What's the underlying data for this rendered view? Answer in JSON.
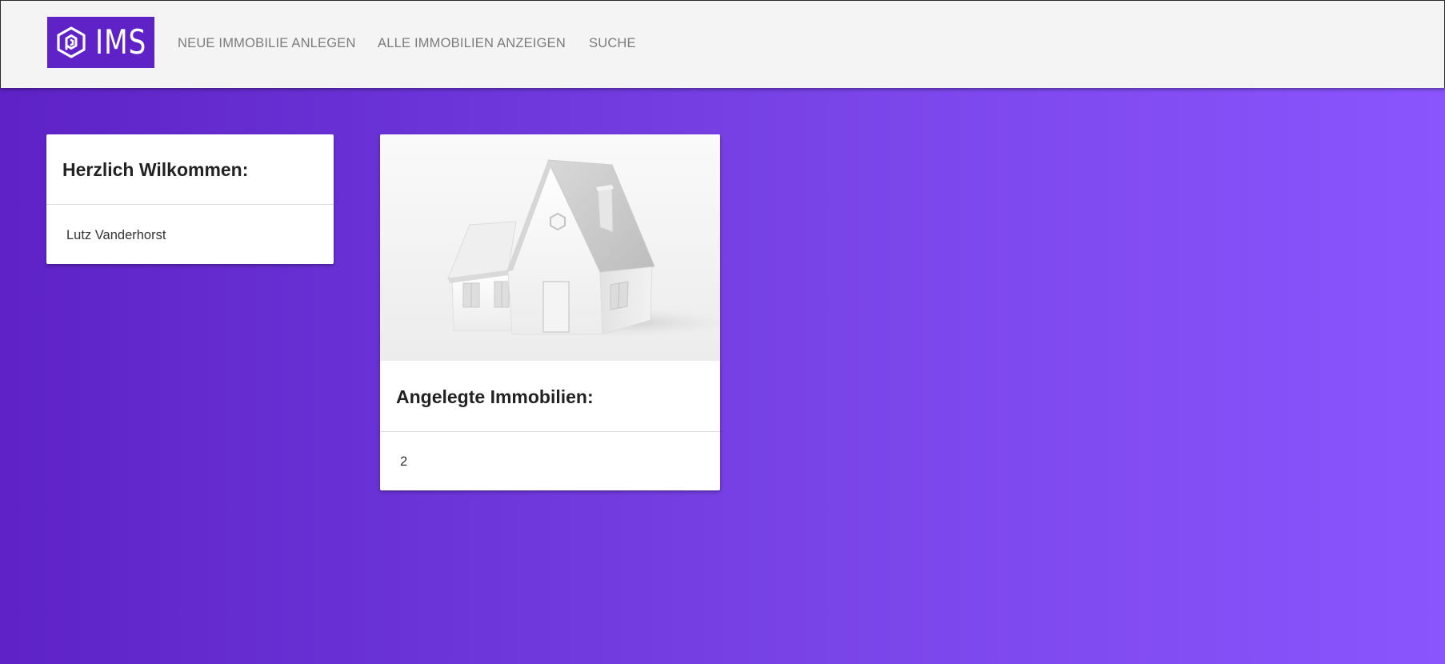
{
  "app": {
    "logo_text": "IMS"
  },
  "nav": {
    "items": [
      {
        "label": "NEUE IMMOBILIE ANLEGEN"
      },
      {
        "label": "ALLE IMMOBILIEN ANZEIGEN"
      },
      {
        "label": "SUCHE"
      }
    ]
  },
  "welcome_card": {
    "title": "Herzlich Wilkommen:",
    "user_name": "Lutz Vanderhorst"
  },
  "properties_card": {
    "image_icon": "house-icon",
    "title": "Angelegte Immobilien:",
    "count": "2"
  },
  "colors": {
    "brand": "#5e22c6",
    "background_start": "#5e22c6",
    "background_end": "#8a55fd",
    "topbar": "#f4f4f4"
  }
}
